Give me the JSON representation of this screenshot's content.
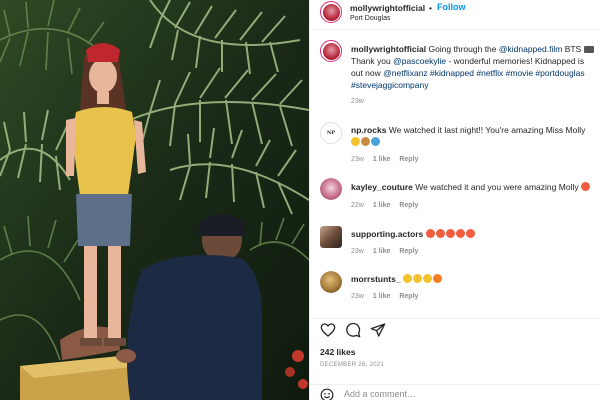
{
  "post": {
    "username": "mollywrightofficial",
    "dot": "•",
    "follow_label": "Follow",
    "location": "Port Douglas"
  },
  "caption": {
    "username": "mollywrightofficial",
    "text1": " Going through the ",
    "link1": "@kidnapped.film",
    "text2": " BTS ",
    "line2a": "Thank you ",
    "link2": "@pascoekylie",
    "line2b": " - wonderful memories! Kidnapped is",
    "line3a": "out now ",
    "link3": "@netflixanz #kidnapped #netflix #movie #portdouglas",
    "link4": "#stevejaggicompany",
    "time": "23w"
  },
  "comments": [
    {
      "username": "np.rocks",
      "text": " We watched it last night!! You're amazing Miss Molly",
      "time": "23w",
      "likes": "1 like",
      "reply": "Reply"
    },
    {
      "username": "kayley_couture",
      "text": " We watched it and you were amazing Molly",
      "time": "22w",
      "likes": "1 like",
      "reply": "Reply"
    },
    {
      "username": "supporting.actors",
      "text": " ",
      "time": "23w",
      "likes": "1 like",
      "reply": "Reply"
    },
    {
      "username": "morrstunts_",
      "text": " ",
      "time": "23w",
      "likes": "1 like",
      "reply": "Reply"
    }
  ],
  "likes_count": "242 likes",
  "post_date": "DECEMBER 26, 2021",
  "add_comment_placeholder": "Add a comment…",
  "icons": {
    "like": "heart-icon",
    "comment": "comment-icon",
    "share": "paper-plane-icon",
    "emoji": "smile-icon"
  },
  "colors": {
    "follow": "#0095f6",
    "link": "#00376b",
    "muted": "#8e8e8e",
    "story_ring": "#d62976"
  }
}
